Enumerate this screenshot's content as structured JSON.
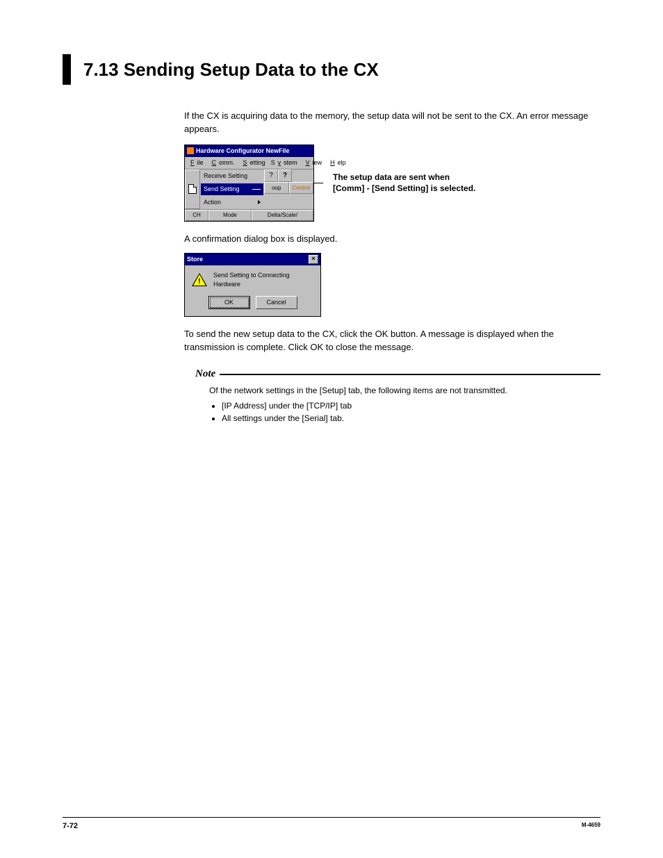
{
  "heading": "7.13  Sending Setup Data to the CX",
  "para1": "If the CX is acquiring data to the memory, the setup data will not be sent to the CX. An error message appears.",
  "shot1": {
    "title": "Hardware Configurator NewFile",
    "menu": {
      "file": "File",
      "comm": "Comm.",
      "setting": "Setting",
      "system": "System",
      "view": "View",
      "help": "Help"
    },
    "dd": {
      "receive": "Receive Setting",
      "send": "Send Setting",
      "action": "Action"
    },
    "tabs": {
      "loop": "oop",
      "control": "Control"
    },
    "headers": {
      "ch": "CH",
      "mode": "Mode",
      "delta": "Delta/Scale/"
    }
  },
  "callout_l1": "The setup data are sent when",
  "callout_l2": "[Comm] - [Send Setting] is selected.",
  "para2": "A confirmation dialog box is displayed.",
  "shot2": {
    "title": "Store",
    "msg": "Send Setting to Connecting Hardware",
    "ok": "OK",
    "cancel": "Cancel"
  },
  "para3": "To send the new setup data to the CX, click the OK button. A message is displayed when the transmission is complete. Click OK to close the message.",
  "note": {
    "label": "Note",
    "intro": "Of the network settings in the [Setup] tab, the following items are not transmitted.",
    "b1": "[IP Address] under the [TCP/IP] tab",
    "b2": "All settings under the [Serial] tab."
  },
  "footer": {
    "page": "7-72",
    "doc": "M-4659"
  }
}
